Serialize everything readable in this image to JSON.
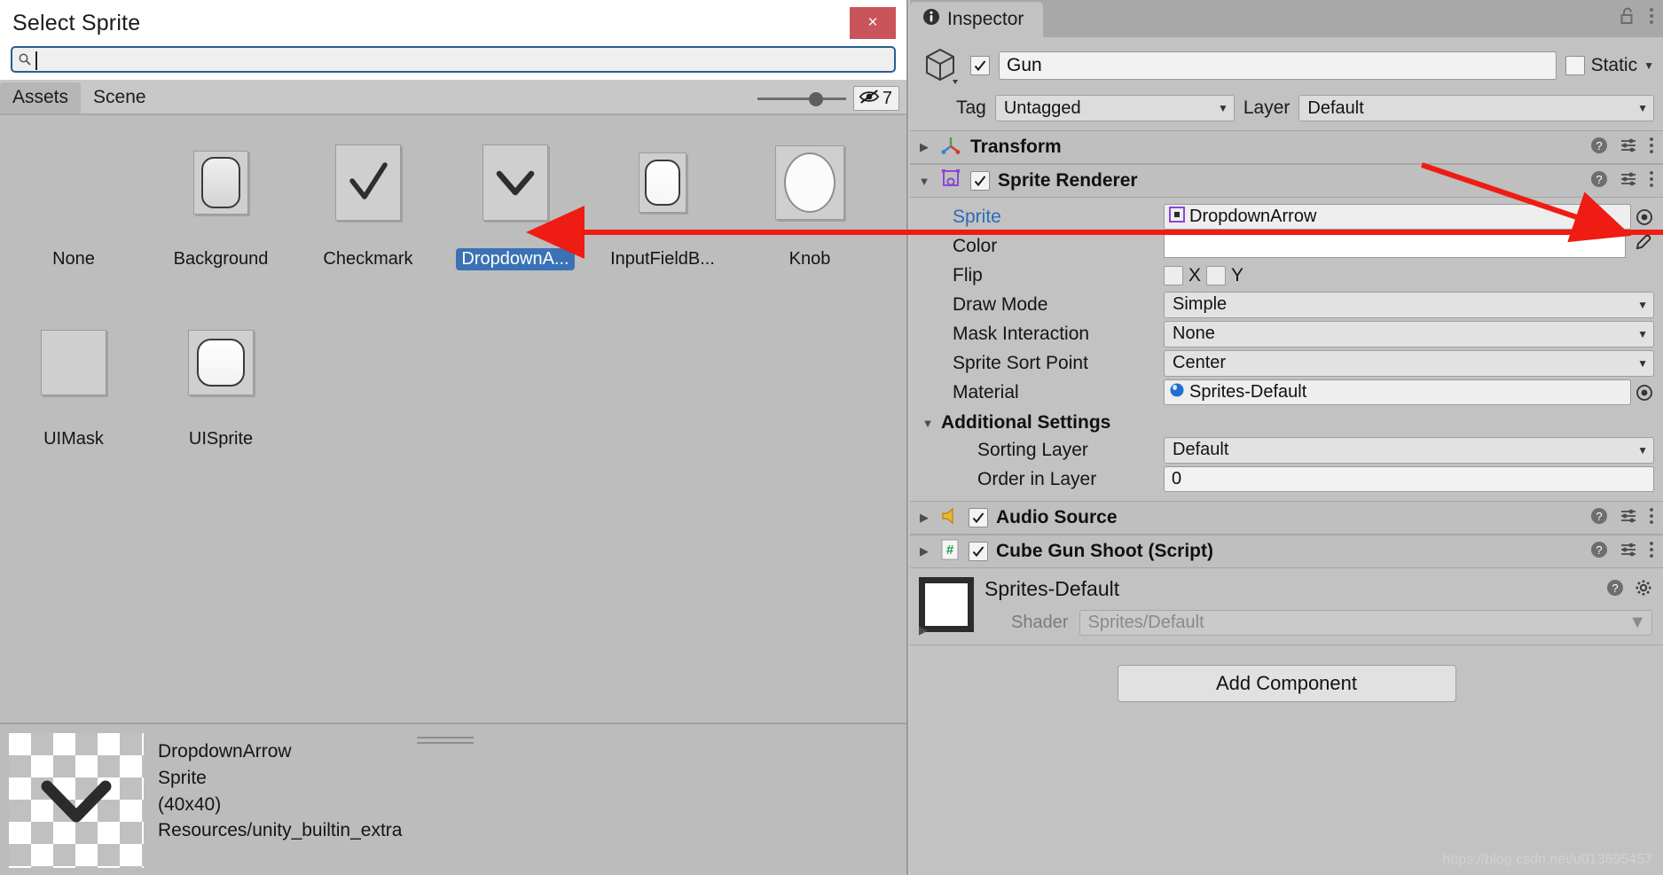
{
  "sprite_picker": {
    "title": "Select Sprite",
    "close_label": "×",
    "search": {
      "value": "",
      "placeholder": "",
      "icon": "search-icon"
    },
    "tabs": [
      {
        "label": "Assets",
        "active": true
      },
      {
        "label": "Scene",
        "active": false
      }
    ],
    "toolbar": {
      "zoom_slider_value": 58,
      "hidden_icon": "eye-off-icon",
      "hidden_count": "7"
    },
    "items": [
      {
        "label": "None",
        "thumb": "none",
        "selected": false
      },
      {
        "label": "Background",
        "thumb": "background",
        "selected": false
      },
      {
        "label": "Checkmark",
        "thumb": "checkmark",
        "selected": false
      },
      {
        "label": "DropdownA...",
        "thumb": "dropdown",
        "selected": true
      },
      {
        "label": "InputFieldB...",
        "thumb": "inputfield",
        "selected": false
      },
      {
        "label": "Knob",
        "thumb": "knob",
        "selected": false
      },
      {
        "label": "UIMask",
        "thumb": "uimask",
        "selected": false
      },
      {
        "label": "UISprite",
        "thumb": "uisprite",
        "selected": false
      }
    ],
    "preview": {
      "name": "DropdownArrow",
      "type": "Sprite",
      "size": "(40x40)",
      "path": "Resources/unity_builtin_extra"
    }
  },
  "inspector": {
    "tab_label": "Inspector",
    "tab_icon": "info-icon",
    "lock_icon": "lock-open-icon",
    "menu_icon": "kebab-menu-icon",
    "game_object": {
      "icon": "cube-icon",
      "enabled": true,
      "name": "Gun",
      "static_label": "Static",
      "static_checked": false,
      "tag_label": "Tag",
      "tag_value": "Untagged",
      "layer_label": "Layer",
      "layer_value": "Default"
    },
    "components": [
      {
        "name": "Transform",
        "icon": "transform-icon",
        "expanded": false,
        "has_checkbox": false,
        "help_icon": "help-icon",
        "preset_icon": "preset-icon",
        "menu_icon": "kebab-menu-icon"
      },
      {
        "name": "Sprite Renderer",
        "icon": "sprite-renderer-icon",
        "expanded": true,
        "has_checkbox": true,
        "checked": true,
        "help_icon": "help-icon",
        "preset_icon": "preset-icon",
        "menu_icon": "kebab-menu-icon",
        "properties": [
          {
            "label": "Sprite",
            "kind": "object",
            "value": "DropdownArrow",
            "value_icon": "sprite-icon"
          },
          {
            "label": "Color",
            "kind": "color",
            "value": "#FFFFFF"
          },
          {
            "label": "Flip",
            "kind": "flip",
            "x_label": "X",
            "y_label": "Y",
            "x": false,
            "y": false
          },
          {
            "label": "Draw Mode",
            "kind": "dropdown",
            "value": "Simple"
          },
          {
            "label": "Mask Interaction",
            "kind": "dropdown",
            "value": "None"
          },
          {
            "label": "Sprite Sort Point",
            "kind": "dropdown",
            "value": "Center"
          },
          {
            "label": "Material",
            "kind": "object",
            "value": "Sprites-Default",
            "value_icon": "material-icon"
          }
        ],
        "additional_settings": {
          "title": "Additional Settings",
          "expanded": true,
          "properties": [
            {
              "label": "Sorting Layer",
              "kind": "dropdown",
              "value": "Default"
            },
            {
              "label": "Order in Layer",
              "kind": "number",
              "value": "0"
            }
          ]
        }
      },
      {
        "name": "Audio Source",
        "icon": "audio-source-icon",
        "expanded": false,
        "has_checkbox": true,
        "checked": true,
        "help_icon": "help-icon",
        "preset_icon": "preset-icon",
        "menu_icon": "kebab-menu-icon"
      },
      {
        "name": "Cube Gun Shoot (Script)",
        "icon": "script-icon",
        "expanded": false,
        "has_checkbox": true,
        "checked": true,
        "help_icon": "help-icon",
        "preset_icon": "preset-icon",
        "menu_icon": "kebab-menu-icon"
      }
    ],
    "material_preview": {
      "name": "Sprites-Default",
      "shader_label": "Shader",
      "shader_value": "Sprites/Default",
      "help_icon": "help-icon",
      "settings_icon": "gear-icon"
    },
    "add_component_label": "Add Component",
    "watermark": "https://blog.csdn.net/u013695457"
  },
  "annotation": {
    "color": "#ee1c13",
    "arrows": [
      {
        "from": [
          1875,
          262
        ],
        "to": [
          598,
          262
        ]
      },
      {
        "from": [
          1605,
          185
        ],
        "to": [
          1832,
          264
        ]
      }
    ]
  }
}
